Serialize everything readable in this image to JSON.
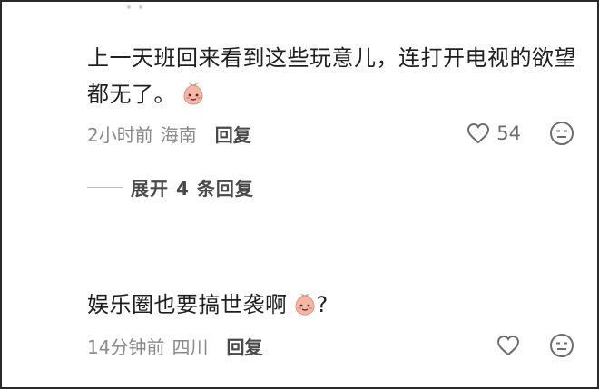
{
  "comments": [
    {
      "text": "上一天班回来看到这些玩意儿，连打开电视的欲望都无了。",
      "emoji": "peach-face-emoji",
      "time": "2小时前",
      "location": "海南",
      "reply_label": "回复",
      "like_count": "54",
      "expand_label": "展开 4 条回复"
    },
    {
      "text": "娱乐圈也要搞世袭啊",
      "suffix": "?",
      "emoji": "peach-face-emoji",
      "time": "14分钟前",
      "location": "四川",
      "reply_label": "回复"
    }
  ],
  "icons": {
    "like": "heart-outline-icon",
    "dislike": "meh-face-icon"
  },
  "colors": {
    "text": "#1f1f1f",
    "meta": "#8a8a8a",
    "emoji_fill": "#f6b7a8"
  }
}
